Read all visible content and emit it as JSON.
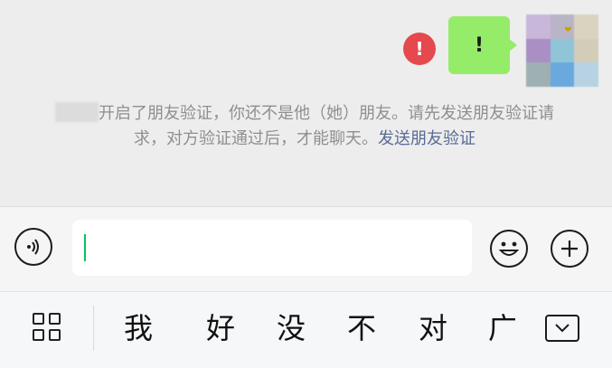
{
  "chat": {
    "error_glyph": "!",
    "outgoing_message": "!",
    "avatar_badge": "❤",
    "notice_text": "开启了朋友验证，你还不是他（她）朋友。请先发送朋友验证请求，对方验证通过后，才能聊天。",
    "notice_link": "发送朋友验证"
  },
  "input": {
    "value": "",
    "placeholder": ""
  },
  "keyboard": {
    "suggestions": [
      "我",
      "好",
      "没",
      "不",
      "对",
      "广"
    ]
  },
  "colors": {
    "bubble": "#95ec69",
    "error": "#e5484d",
    "link": "#576b95",
    "caret": "#07c160"
  },
  "icons": [
    "voice-icon",
    "emoji-icon",
    "plus-icon",
    "keyboard-grid-icon",
    "keyboard-hide-icon"
  ]
}
